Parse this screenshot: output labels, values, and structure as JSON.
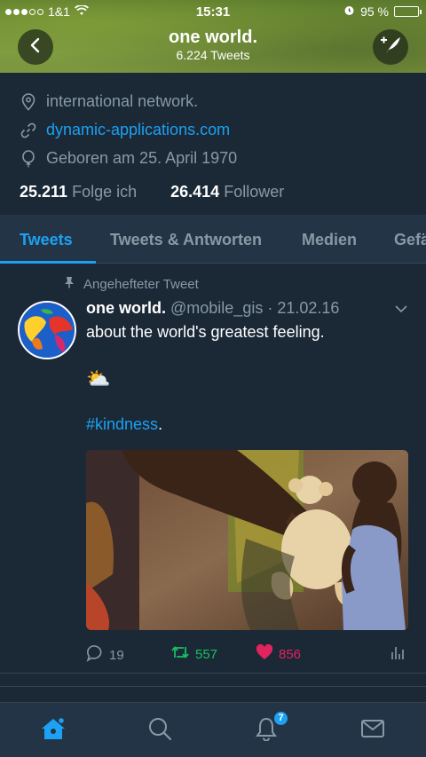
{
  "status_bar": {
    "carrier": "1&1",
    "time": "15:31",
    "battery": "95 %",
    "battery_level": 0.95
  },
  "header": {
    "title": "one world.",
    "subtitle": "6.224 Tweets",
    "back_icon": "chevron-left-icon",
    "compose_icon": "compose-tweet-icon"
  },
  "profile": {
    "location": "international network.",
    "website": "dynamic-applications.com",
    "birthday": "Geboren am 25. April 1970",
    "following_count": "25.211",
    "following_label": "Folge ich",
    "followers_count": "26.414",
    "followers_label": "Follower"
  },
  "tabs": [
    {
      "label": "Tweets",
      "active": true
    },
    {
      "label": "Tweets & Antworten",
      "active": false
    },
    {
      "label": "Medien",
      "active": false
    },
    {
      "label": "Gefä",
      "active": false
    }
  ],
  "tweet": {
    "pinned_label": "Angehefteter Tweet",
    "name": "one world.",
    "handle": "@mobile_gis",
    "date": "· 21.02.16",
    "text": "about the world's greatest feeling.",
    "emoji": "⛅",
    "hashtag": "#kindness",
    "hashtag_suffix": ".",
    "replies": "19",
    "retweets": "557",
    "likes": "856"
  },
  "bottom_nav": {
    "items": [
      "home-icon",
      "search-icon",
      "notifications-icon",
      "messages-icon"
    ],
    "notification_badge": "7"
  },
  "colors": {
    "background": "#1b2836",
    "accent": "#1da1f2",
    "retweet": "#17bf63",
    "like": "#e0245e",
    "muted": "#8899a6"
  }
}
